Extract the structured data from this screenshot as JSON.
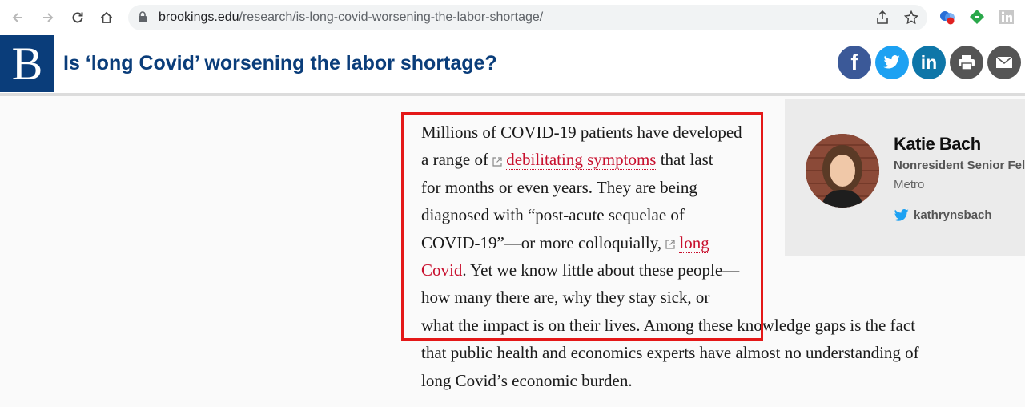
{
  "browser": {
    "url_domain": "brookings.edu",
    "url_path": "/research/is-long-covid-worsening-the-labor-shortage/"
  },
  "site": {
    "logo_letter": "B",
    "title": "Is ‘long Covid’ worsening the labor shortage?",
    "share": [
      {
        "name": "facebook",
        "glyph": "f",
        "color": "#3b5998"
      },
      {
        "name": "twitter",
        "color": "#1da1f2"
      },
      {
        "name": "linkedin",
        "glyph": "in",
        "color": "#0e76a8"
      },
      {
        "name": "print",
        "color": "#555555"
      },
      {
        "name": "email",
        "color": "#555555"
      }
    ]
  },
  "article": {
    "line1": "Millions of COVID-19 patients have developed",
    "line2_pre": "a range of ",
    "link1": "debilitating symptoms",
    "line2_post": " that last",
    "line3": "for months or even years. They are being",
    "line4": "diagnosed with “post-acute sequelae of",
    "line5_pre": "COVID-19”—or more colloquially, ",
    "link2a": "long",
    "link2b": "Covid",
    "line6_post": ". Yet we know little about these people—",
    "line7": "how many there are, why they stay sick, or",
    "line8": "what the impact is on their lives. Among these knowledge gaps is the fact",
    "line9": "that public health and economics experts have almost no understanding of",
    "line10": "long Covid’s economic burden."
  },
  "author": {
    "name": "Katie Bach",
    "role": "Nonresident Senior Fellow",
    "dept": "Metro",
    "twitter": "kathrynsbach"
  }
}
